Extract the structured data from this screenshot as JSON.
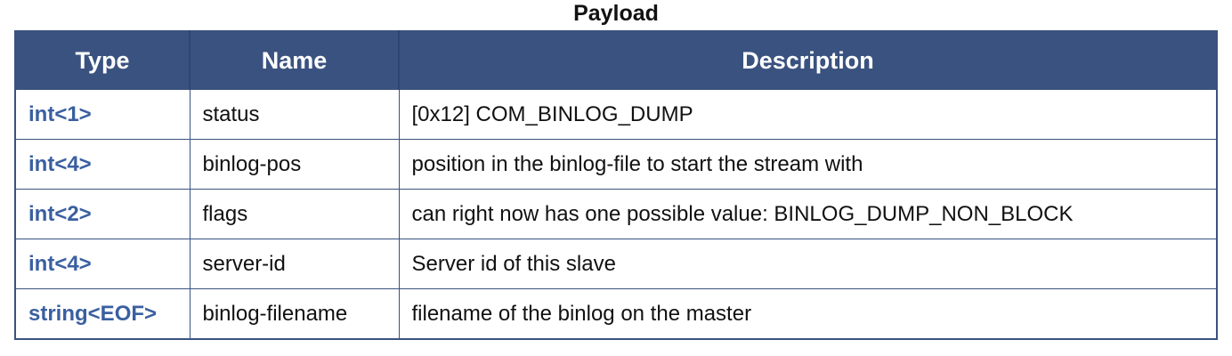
{
  "caption": "Payload",
  "table": {
    "headers": [
      "Type",
      "Name",
      "Description"
    ],
    "rows": [
      {
        "type": "int<1>",
        "name": "status",
        "description": "[0x12] COM_BINLOG_DUMP"
      },
      {
        "type": "int<4>",
        "name": "binlog-pos",
        "description": "position in the binlog-file to start the stream with"
      },
      {
        "type": "int<2>",
        "name": "flags",
        "description": "can right now has one possible value: BINLOG_DUMP_NON_BLOCK"
      },
      {
        "type": "int<4>",
        "name": "server-id",
        "description": "Server id of this slave"
      },
      {
        "type": "string<EOF>",
        "name": "binlog-filename",
        "description": "filename of the binlog on the master"
      }
    ]
  },
  "colors": {
    "header_bg": "#3a527f",
    "header_text": "#ffffff",
    "type_text": "#3a5fa0",
    "border": "#3a527f"
  }
}
